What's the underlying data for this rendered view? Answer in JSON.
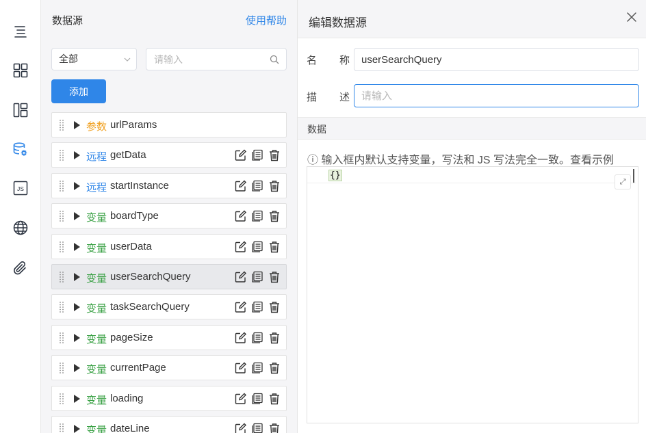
{
  "rail": {
    "items": [
      {
        "id": "outline",
        "icon": "outline-icon"
      },
      {
        "id": "components",
        "icon": "grid-icon"
      },
      {
        "id": "layout",
        "icon": "layout-icon"
      },
      {
        "id": "datasource",
        "icon": "database-settings-icon",
        "active": true
      },
      {
        "id": "js",
        "icon": "js-icon",
        "label": "JS"
      },
      {
        "id": "i18n",
        "icon": "globe-icon"
      },
      {
        "id": "attachment",
        "icon": "paperclip-icon"
      }
    ]
  },
  "panel": {
    "title": "数据源",
    "help": "使用帮助",
    "filter_value": "全部",
    "search_placeholder": "请输入",
    "add_label": "添加",
    "items": [
      {
        "type": "参数",
        "kind": "param",
        "name": "urlParams",
        "actions": false
      },
      {
        "type": "远程",
        "kind": "remote",
        "name": "getData",
        "actions": true
      },
      {
        "type": "远程",
        "kind": "remote",
        "name": "startInstance",
        "actions": true
      },
      {
        "type": "变量",
        "kind": "var",
        "name": "boardType",
        "actions": true
      },
      {
        "type": "变量",
        "kind": "var",
        "name": "userData",
        "actions": true
      },
      {
        "type": "变量",
        "kind": "var",
        "name": "userSearchQuery",
        "actions": true,
        "selected": true
      },
      {
        "type": "变量",
        "kind": "var",
        "name": "taskSearchQuery",
        "actions": true
      },
      {
        "type": "变量",
        "kind": "var",
        "name": "pageSize",
        "actions": true
      },
      {
        "type": "变量",
        "kind": "var",
        "name": "currentPage",
        "actions": true
      },
      {
        "type": "变量",
        "kind": "var",
        "name": "loading",
        "actions": true
      },
      {
        "type": "变量",
        "kind": "var",
        "name": "dateLine",
        "actions": true
      }
    ]
  },
  "editor": {
    "title": "编辑数据源",
    "name_label_1": "名",
    "name_label_2": "称",
    "name_value": "userSearchQuery",
    "desc_label_1": "描",
    "desc_label_2": "述",
    "desc_placeholder": "请输入",
    "section_title": "数据",
    "hint": "ⓘ 输入框内默认支持变量，写法和 JS 写法完全一致。查看示例",
    "code": "{}"
  },
  "colors": {
    "accent": "#2f86e8",
    "param": "#f0a020",
    "remote": "#2f86e8",
    "var": "#3aa145"
  }
}
